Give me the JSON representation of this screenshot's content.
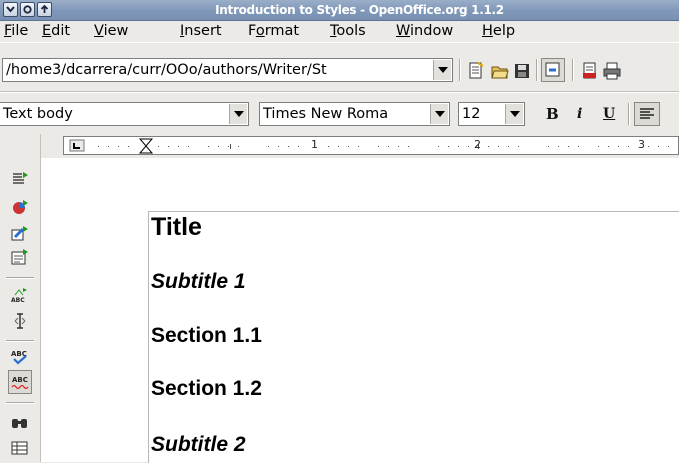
{
  "window": {
    "title": "Introduction to Styles - OpenOffice.org 1.1.2"
  },
  "menubar": {
    "items": [
      {
        "label": "File",
        "ul": "F",
        "rest": "ile"
      },
      {
        "label": "Edit",
        "ul": "E",
        "rest": "dit"
      },
      {
        "label": "View",
        "ul": "V",
        "rest": "iew"
      },
      {
        "label": "Insert",
        "ul": "I",
        "rest": "nsert"
      },
      {
        "label": "Format",
        "pre": "F",
        "ul": "o",
        "rest": "rmat"
      },
      {
        "label": "Tools",
        "ul": "T",
        "rest": "ools"
      },
      {
        "label": "Window",
        "ul": "W",
        "rest": "indow"
      },
      {
        "label": "Help",
        "ul": "H",
        "rest": "elp"
      }
    ]
  },
  "function_bar": {
    "url_value": "/home3/dcarrera/curr/OOo/authors/Writer/St"
  },
  "object_bar": {
    "paragraph_style": "Text body",
    "font_name": "Times New Roma",
    "font_size": "12",
    "bold_label": "B",
    "italic_label": "i",
    "underline_label": "U"
  },
  "ruler": {
    "numbers": [
      "1",
      "2",
      "3"
    ]
  },
  "document": {
    "paragraphs": [
      {
        "text": "Title",
        "style": "title"
      },
      {
        "text": "Subtitle 1",
        "style": "subtitle"
      },
      {
        "text": "Section 1.1",
        "style": "section"
      },
      {
        "text": "Section 1.2",
        "style": "section"
      },
      {
        "text": "Subtitle 2",
        "style": "subtitle"
      }
    ]
  },
  "colors": {
    "titlebar": "#7f97b8",
    "canvas": "#ffffff",
    "toolbar": "#eceae6"
  },
  "sidebar": {
    "icons": [
      "insert-icon",
      "insert-fields-icon",
      "insert-objects-icon",
      "show-draw-functions-icon",
      "edit-autotext-icon",
      "hyperlink-icon",
      "direct-cursor-icon",
      "spellcheck-icon",
      "autospellcheck-icon",
      "find-replace-icon",
      "data-sources-icon"
    ]
  }
}
